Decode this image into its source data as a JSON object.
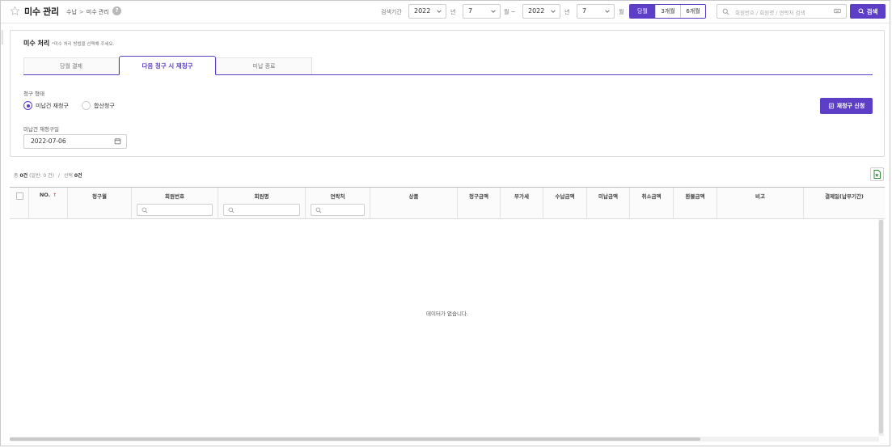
{
  "header": {
    "title": "미수 관리",
    "breadcrumb": [
      "수납",
      "미수 관리"
    ],
    "help": "?",
    "period_label": "검색기간",
    "start_year": "2022",
    "start_month": "7",
    "end_year": "2022",
    "end_month": "7",
    "year_unit": "년",
    "month_unit": "월 ~",
    "month_unit_end": "월",
    "ranges": [
      "당월",
      "3개월",
      "6개월"
    ],
    "active_range": "당월",
    "search_placeholder": "회원번호 / 회원명 / 연락처 검색",
    "search_button": "검색"
  },
  "panel": {
    "title": "미수 처리",
    "hint": "*미수 처리 방법을 선택해 주세요.",
    "tabs": [
      "당월 결제",
      "다음 청구 시 재청구",
      "미납 종료"
    ],
    "active_tab": "다음 청구 시 재청구",
    "billing_status_label": "청구 형태",
    "options": [
      "미납건 재청구",
      "합산청구"
    ],
    "selected_option": "미납건 재청구",
    "rebill_month_label": "미납건 재청구일",
    "rebill_date": "2022-07-06",
    "rebill_button": "재청구 신청"
  },
  "summary": {
    "total_prefix": "총",
    "total": "0건",
    "total_detail": "(일반: 0 건)",
    "sep": "/",
    "selected_prefix": "선택",
    "selected": "0건"
  },
  "table": {
    "columns": [
      "NO.",
      "청구월",
      "회원번호",
      "회원명",
      "연락처",
      "상품",
      "청구금액",
      "부가세",
      "수납금액",
      "미납금액",
      "취소금액",
      "환불금액",
      "비고",
      "결제일(납부기간)"
    ],
    "sort_indicator": "↑",
    "empty_message": "데이터가 없습니다."
  },
  "colors": {
    "accent": "#5c3ec7"
  }
}
